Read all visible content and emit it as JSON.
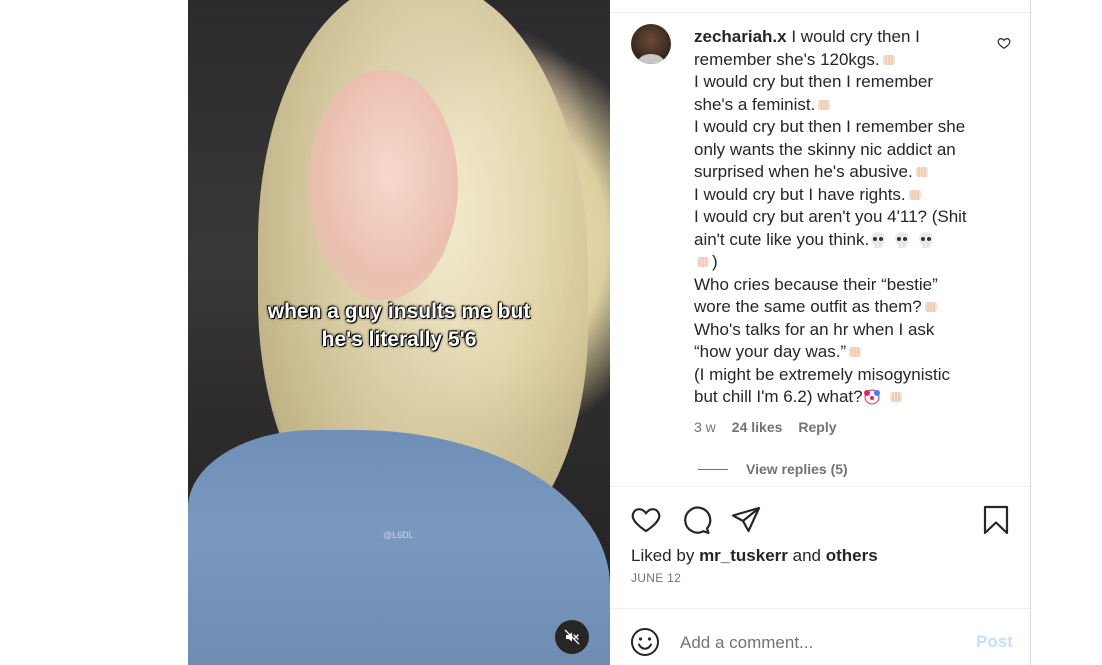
{
  "video": {
    "caption": "when a guy insults me but\nhe's literally 5'6",
    "watermark": "@L6DL",
    "mute_icon": "speaker-muted-icon"
  },
  "comment": {
    "username": "zechariah.x",
    "lines": [
      "I would cry then I",
      "remember she's 120kgs.",
      "I would cry but then I remember",
      "she's a feminist.",
      "I would cry but then I remember she",
      "only wants the skinny nic addict an",
      "surprised when he's abusive.",
      "I would cry but I have rights.",
      "I would cry but aren't you 4'11? (Shit",
      "ain't cute like you think.",
      ")",
      "Who cries because their “bestie”",
      "wore the same outfit as them?",
      "Who's talks for an hr when I ask",
      "“how your day was.”",
      "(I might be extremely misogynistic",
      "but chill I'm 6.2) what?"
    ],
    "age": "3 w",
    "likes": "24 likes",
    "reply_label": "Reply",
    "view_replies": "View replies (5)",
    "emoji_icons": [
      "fist-bump-emoji",
      "skull-emoji",
      "clown-emoji"
    ]
  },
  "actions": {
    "icons": [
      "heart-icon",
      "comment-icon",
      "share-icon",
      "bookmark-icon"
    ]
  },
  "liked_by": {
    "prefix": "Liked by",
    "user": "mr_tuskerr",
    "and": "and",
    "others": "others"
  },
  "date": "JUNE 12",
  "composer": {
    "placeholder": "Add a comment...",
    "post_label": "Post"
  },
  "colors": {
    "text": "#262626",
    "secondary": "#737373",
    "post_disabled": "#c0dffd",
    "divider": "#efefef"
  }
}
